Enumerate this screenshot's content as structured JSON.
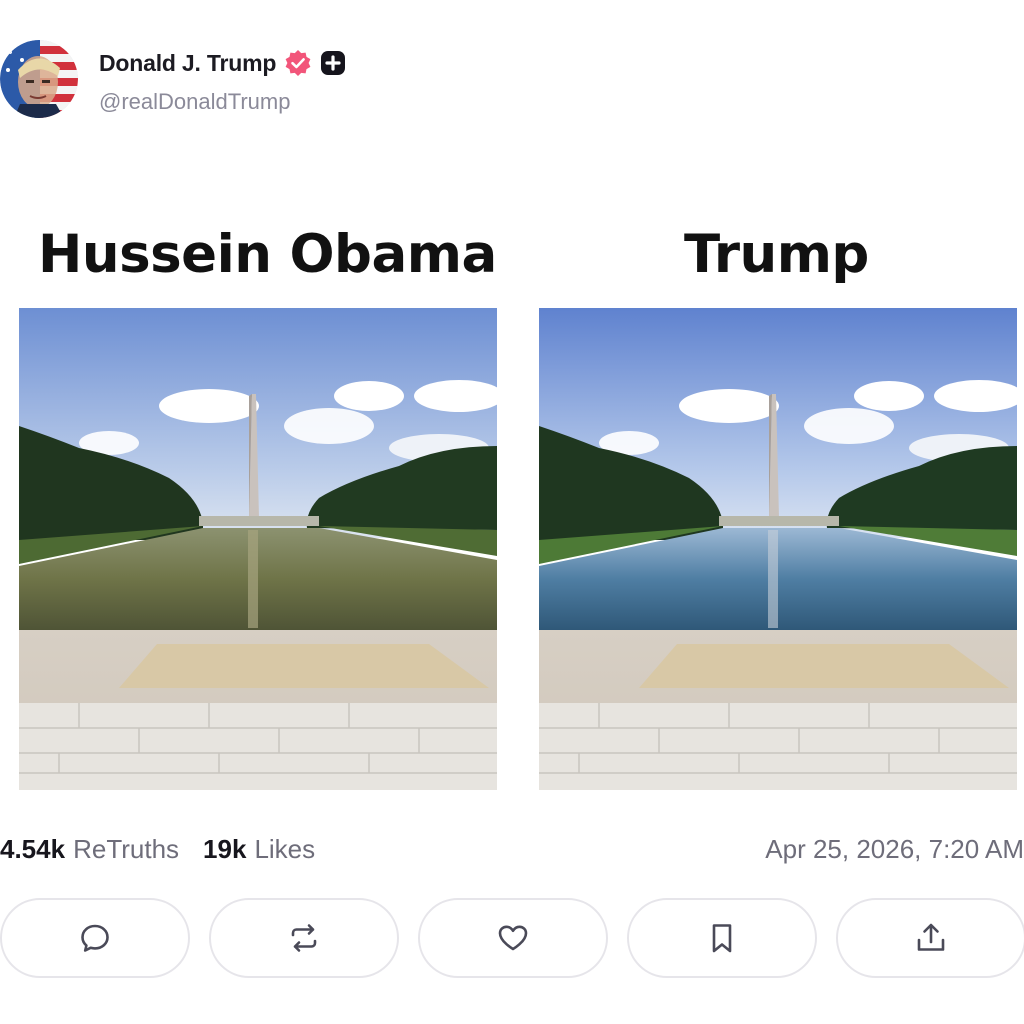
{
  "post": {
    "author": {
      "display_name": "Donald J. Trump",
      "handle": "@realDonaldTrump",
      "avatar_icon": "avatar-flag-portrait",
      "verified_icon": "verified-badge-icon",
      "verified_color": "#f2557a",
      "plus_icon": "plus-badge-icon"
    },
    "media": {
      "left_caption": "Hussein Obama",
      "right_caption": "Trump",
      "left_image": "washington-monument-reflecting-pool-murky",
      "right_image": "washington-monument-reflecting-pool-clean"
    },
    "stats": {
      "retruths_count": "4.54k",
      "retruths_label": "ReTruths",
      "likes_count": "19k",
      "likes_label": "Likes"
    },
    "timestamp": "Apr 25, 2026, 7:20 AM"
  },
  "actions": [
    {
      "name": "reply",
      "icon": "comment-icon"
    },
    {
      "name": "retruth",
      "icon": "repost-icon"
    },
    {
      "name": "like",
      "icon": "heart-icon"
    },
    {
      "name": "bookmark",
      "icon": "bookmark-icon"
    },
    {
      "name": "share",
      "icon": "share-icon"
    }
  ],
  "colors": {
    "text_primary": "#17161d",
    "text_secondary": "#6e6d7a",
    "border": "#e6e5ea",
    "icon": "#4a4a58"
  }
}
